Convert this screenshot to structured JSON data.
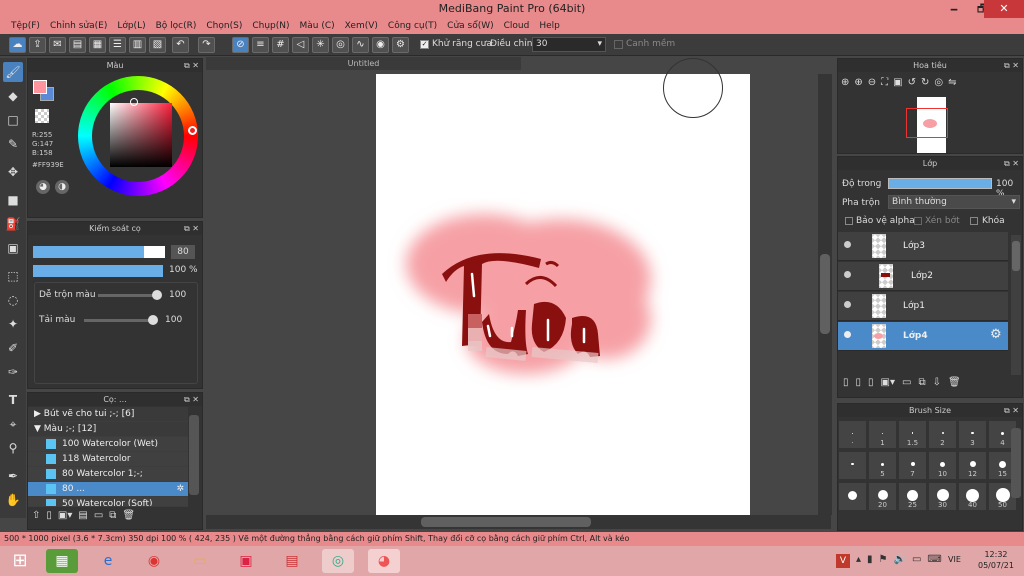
{
  "window": {
    "title": "MediBang Paint Pro (64bit)",
    "minimize": "🗕",
    "maximize": "🗗",
    "close": "✕"
  },
  "menu": [
    "Tệp(F)",
    "Chỉnh sửa(E)",
    "Lớp(L)",
    "Bộ lọc(R)",
    "Chọn(S)",
    "Chụp(N)",
    "Màu (C)",
    "Xem(V)",
    "Công cụ(T)",
    "Cửa sổ(W)",
    "Cloud",
    "Help"
  ],
  "toolbar": {
    "antialias_label": "Khử răng cưa",
    "correction_label": "Điều chỉnh",
    "correction_value": "30",
    "snap_label": "Canh mềm"
  },
  "color_panel": {
    "title": "Màu",
    "r": "R:255",
    "g": "G:147",
    "b": "B:158",
    "hex": "#FF939E",
    "primary": "#ff939e",
    "secondary": "#5b8bd6"
  },
  "brush_control": {
    "title": "Kiểm soát cọ",
    "size": "80",
    "opacity": "100 %",
    "blend_label": "Dễ trộn màu",
    "blend_value": "100",
    "amount_label": "Tải màu",
    "amount_value": "100"
  },
  "brush_panel": {
    "title": "Cọ: ...",
    "groups": [
      {
        "label": "Bút vẽ cho tui ;-; [6]"
      },
      {
        "label": "Màu ;-; [12]"
      }
    ],
    "items": [
      {
        "size": "100",
        "name": "Watercolor (Wet)"
      },
      {
        "size": "118",
        "name": "Watercolor"
      },
      {
        "size": "80",
        "name": "Watercolor 1;-;"
      },
      {
        "size": "80",
        "name": "..."
      },
      {
        "size": "50",
        "name": "Watercolor (Soft)"
      }
    ]
  },
  "document": {
    "tab": "Untitled"
  },
  "canvas_art": {
    "letters": "Tiểu"
  },
  "navigator": {
    "title": "Hoa tiêu"
  },
  "layer_panel": {
    "title": "Lớp",
    "opacity_label": "Độ trong",
    "opacity_value": "100 %",
    "blend_label": "Pha trộn",
    "blend_value": "Bình thường",
    "protect_alpha": "Bảo vệ alpha",
    "clip": "Xén bớt",
    "lock": "Khóa",
    "layers": [
      {
        "name": "Lớp3"
      },
      {
        "name": "Lớp2"
      },
      {
        "name": "Lớp1"
      },
      {
        "name": "Lớp4"
      }
    ]
  },
  "brush_size": {
    "title": "Brush Size",
    "sizes": [
      [
        "·",
        "1",
        "1.5",
        "2",
        "3",
        "4"
      ],
      [
        "",
        "5",
        "7",
        "10",
        "12",
        "15"
      ],
      [
        "",
        "20",
        "25",
        "30",
        "40",
        "50"
      ]
    ]
  },
  "status": {
    "text": "500 * 1000 pixel   (3.6 * 7.3cm)   350 dpi   100 %   ( 424, 235 )   Vẽ một đường thẳng bằng cách giữ phím Shift, Thay đổi cỡ cọ bằng cách giữ phím Ctrl, Alt và kéo"
  },
  "taskbar": {
    "lang": "VIE",
    "time": "12:32",
    "date": "05/07/21"
  }
}
